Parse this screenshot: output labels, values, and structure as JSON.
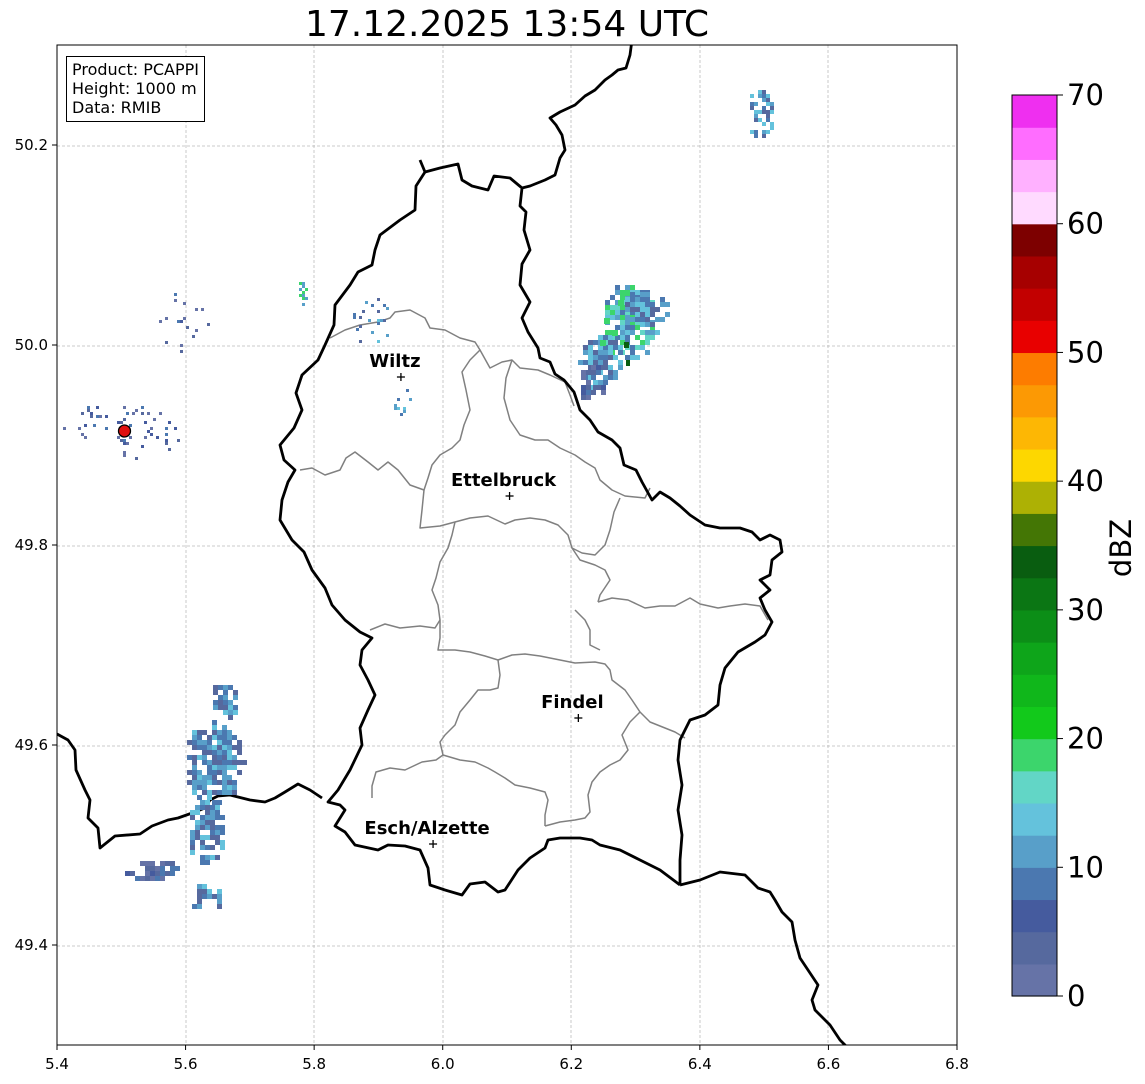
{
  "title": "17.12.2025 13:54 UTC",
  "info": {
    "product": "Product: PCAPPI",
    "height": "Height: 1000 m",
    "data": "Data: RMIB"
  },
  "axes": {
    "x_ticks": [
      "5.4",
      "5.6",
      "5.8",
      "6.0",
      "6.2",
      "6.4",
      "6.6",
      "6.8"
    ],
    "y_ticks": [
      "50.2",
      "50.0",
      "49.8",
      "49.6",
      "49.4"
    ]
  },
  "colorbar": {
    "label": "dBZ",
    "ticks": [
      "0",
      "10",
      "20",
      "30",
      "40",
      "50",
      "60",
      "70"
    ],
    "colors": [
      "#6673a7",
      "#56699e",
      "#455b9e",
      "#4b78b0",
      "#589fc9",
      "#64c2dc",
      "#62d6c6",
      "#3cd56c",
      "#12c91b",
      "#10b71b",
      "#0ea51a",
      "#0c8e17",
      "#0b7614",
      "#095d10",
      "#447605",
      "#adb104",
      "#fdd700",
      "#fdb704",
      "#fc9904",
      "#fd7c00",
      "#e80000",
      "#c20000",
      "#a60000",
      "#7d0000",
      "#ffdaff",
      "#ffb1ff",
      "#ff6dff",
      "#ef2ff0"
    ]
  },
  "cities": [
    {
      "name": "Wiltz"
    },
    {
      "name": "Ettelbruck"
    },
    {
      "name": "Findel"
    },
    {
      "name": "Esch/Alzette"
    }
  ],
  "chart_data": {
    "type": "heatmap",
    "title": "17.12.2025 13:54 UTC",
    "xlim": [
      5.4,
      6.8
    ],
    "ylim": [
      49.3,
      50.3
    ],
    "colorbar_label": "dBZ",
    "colorbar_range": [
      0,
      70
    ],
    "radar_site": {
      "lon": 5.505,
      "lat": 49.914
    },
    "cities": [
      {
        "name": "Wiltz",
        "lon": 5.935,
        "lat": 49.968
      },
      {
        "name": "Ettelbruck",
        "lon": 6.104,
        "lat": 49.849
      },
      {
        "name": "Findel",
        "lon": 6.211,
        "lat": 49.627
      },
      {
        "name": "Esch/Alzette",
        "lon": 5.985,
        "lat": 49.501
      }
    ]
  }
}
